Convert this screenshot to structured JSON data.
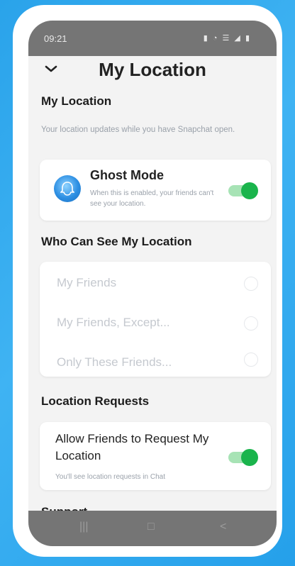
{
  "status": {
    "time": "09:21",
    "icons": "▮ ◔ ☰ ◢ ▮"
  },
  "header": {
    "title": "My Location"
  },
  "my_location": {
    "section_title": "My Location",
    "description": "Your location updates while you have Snapchat open."
  },
  "ghost_mode": {
    "title": "Ghost Mode",
    "description": "When this is enabled, your friends can't see your location.",
    "enabled": true
  },
  "who_can_see": {
    "section_title": "Who Can See My Location",
    "options": [
      "My Friends",
      "My Friends, Except...",
      "Only These Friends..."
    ]
  },
  "location_requests": {
    "section_title": "Location Requests",
    "title": "Allow Friends to Request My Location",
    "subtitle": "You'll see location requests in Chat",
    "enabled": true
  },
  "support": {
    "section_title": "Support"
  },
  "navbar": {
    "recents": "|||",
    "home": "□",
    "back": "<"
  },
  "colors": {
    "accent_green": "#1ab44c",
    "background_blue": "#2aa3ea"
  }
}
